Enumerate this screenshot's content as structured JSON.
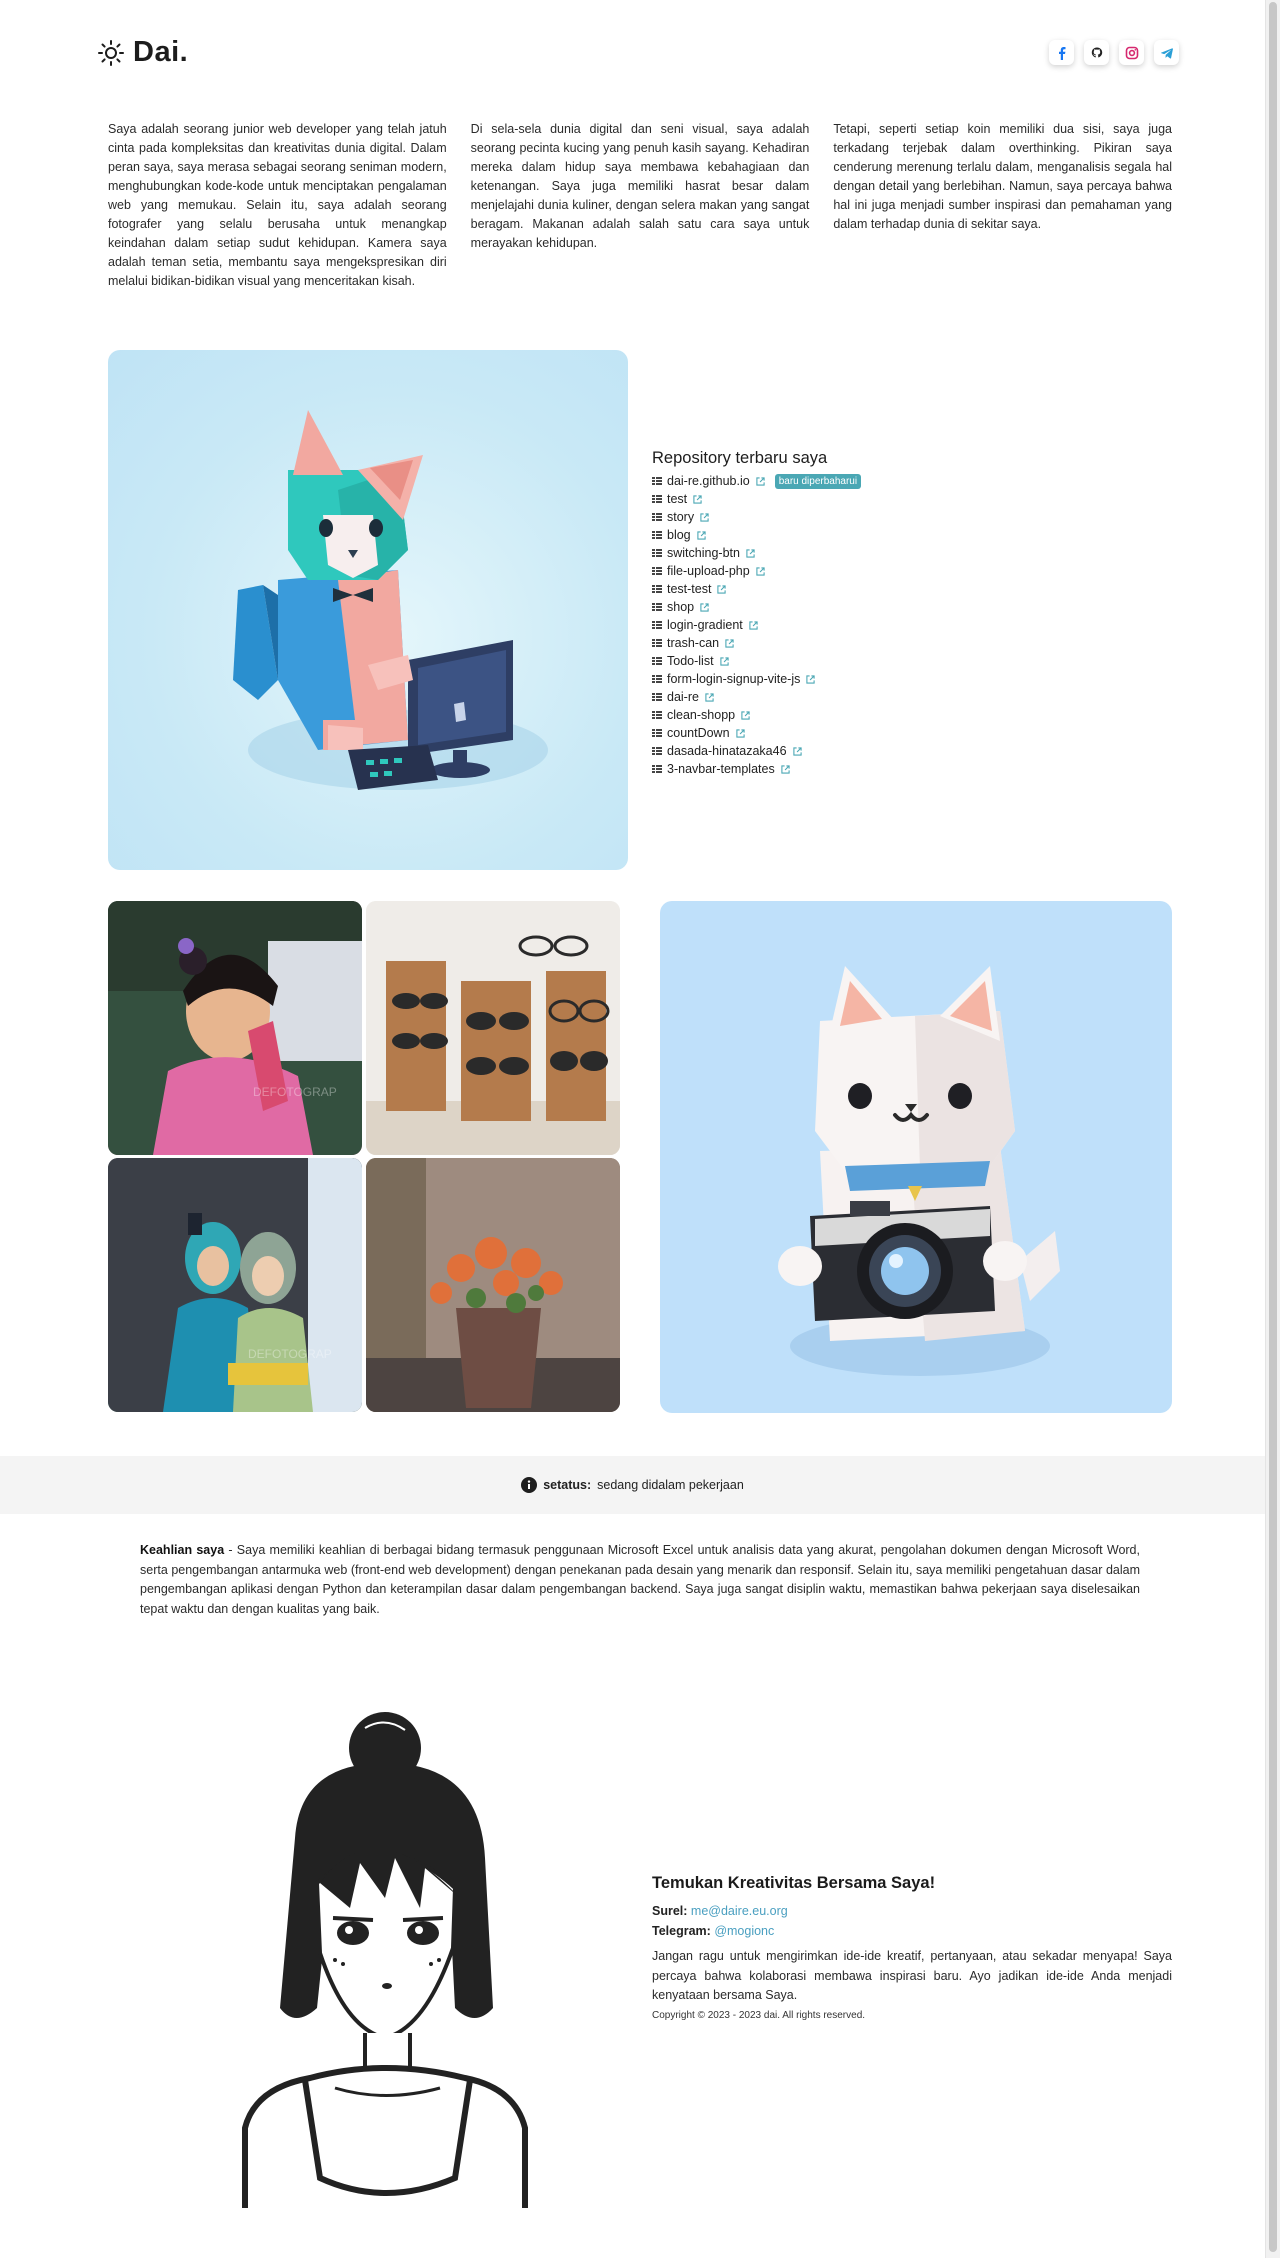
{
  "header": {
    "logo": "Dai.",
    "socials": [
      {
        "icon": "facebook-icon",
        "color": "#1877f2"
      },
      {
        "icon": "github-icon",
        "color": "#222222"
      },
      {
        "icon": "instagram-icon",
        "color": "#d6286f"
      },
      {
        "icon": "telegram-icon",
        "color": "#2a9fd6"
      }
    ]
  },
  "intro": {
    "col1": "Saya adalah seorang junior web developer yang telah jatuh cinta pada kompleksitas dan kreativitas dunia digital. Dalam peran saya, saya merasa sebagai seorang seniman modern, menghubungkan kode-kode untuk menciptakan pengalaman web yang memukau. Selain itu, saya adalah seorang fotografer yang selalu berusaha untuk menangkap keindahan dalam setiap sudut kehidupan. Kamera saya adalah teman setia, membantu saya mengekspresikan diri melalui bidikan-bidikan visual yang menceritakan kisah.",
    "col2": "Di sela-sela dunia digital dan seni visual, saya adalah seorang pecinta kucing yang penuh kasih sayang. Kehadiran mereka dalam hidup saya membawa kebahagiaan dan ketenangan. Saya juga memiliki hasrat besar dalam menjelajahi dunia kuliner, dengan selera makan yang sangat beragam. Makanan adalah salah satu cara saya untuk merayakan kehidupan.",
    "col3": "Tetapi, seperti setiap koin memiliki dua sisi, saya juga terkadang terjebak dalam overthinking. Pikiran saya cenderung merenung terlalu dalam, menganalisis segala hal dengan detail yang berlebihan. Namun, saya percaya bahwa hal ini juga menjadi sumber inspirasi dan pemahaman yang dalam terhadap dunia di sekitar saya."
  },
  "repos": {
    "title": "Repository terbaru saya",
    "badge": "baru diperbaharui",
    "items": [
      "dai-re.github.io",
      "test",
      "story",
      "blog",
      "switching-btn",
      "file-upload-php",
      "test-test",
      "shop",
      "login-gradient",
      "trash-can",
      "Todo-list",
      "form-login-signup-vite-js",
      "dai-re",
      "clean-shopp",
      "countDown",
      "dasada-hinatazaka46",
      "3-navbar-templates"
    ]
  },
  "status": {
    "label": "setatus:",
    "value": "sedang didalam pekerjaan"
  },
  "skills": {
    "label": "Keahlian saya",
    "text": " - Saya memiliki keahlian di berbagai bidang termasuk penggunaan Microsoft Excel untuk analisis data yang akurat, pengolahan dokumen dengan Microsoft Word, serta pengembangan antarmuka web (front-end web development) dengan penekanan pada desain yang menarik dan responsif. Selain itu, saya memiliki pengetahuan dasar dalam pengembangan aplikasi dengan Python dan keterampilan dasar dalam pengembangan backend. Saya juga sangat disiplin waktu, memastikan bahwa pekerjaan saya diselesaikan tepat waktu dan dengan kualitas yang baik."
  },
  "contact": {
    "title": "Temukan Kreativitas Bersama Saya!",
    "email_label": "Surel:",
    "email": "me@daire.eu.org",
    "telegram_label": "Telegram:",
    "telegram": "@mogionc",
    "message": "Jangan ragu untuk mengirimkan ide-ide kreatif, pertanyaan, atau sekadar menyapa! Saya percaya bahwa kolaborasi membawa inspirasi baru. Ayo jadikan ide-ide Anda menjadi kenyataan bersama Saya.",
    "copyright": "Copyright © 2023 - 2023 dai. All rights reserved."
  },
  "colors": {
    "accent": "#4aa7b4",
    "link": "#4a9fc0"
  }
}
